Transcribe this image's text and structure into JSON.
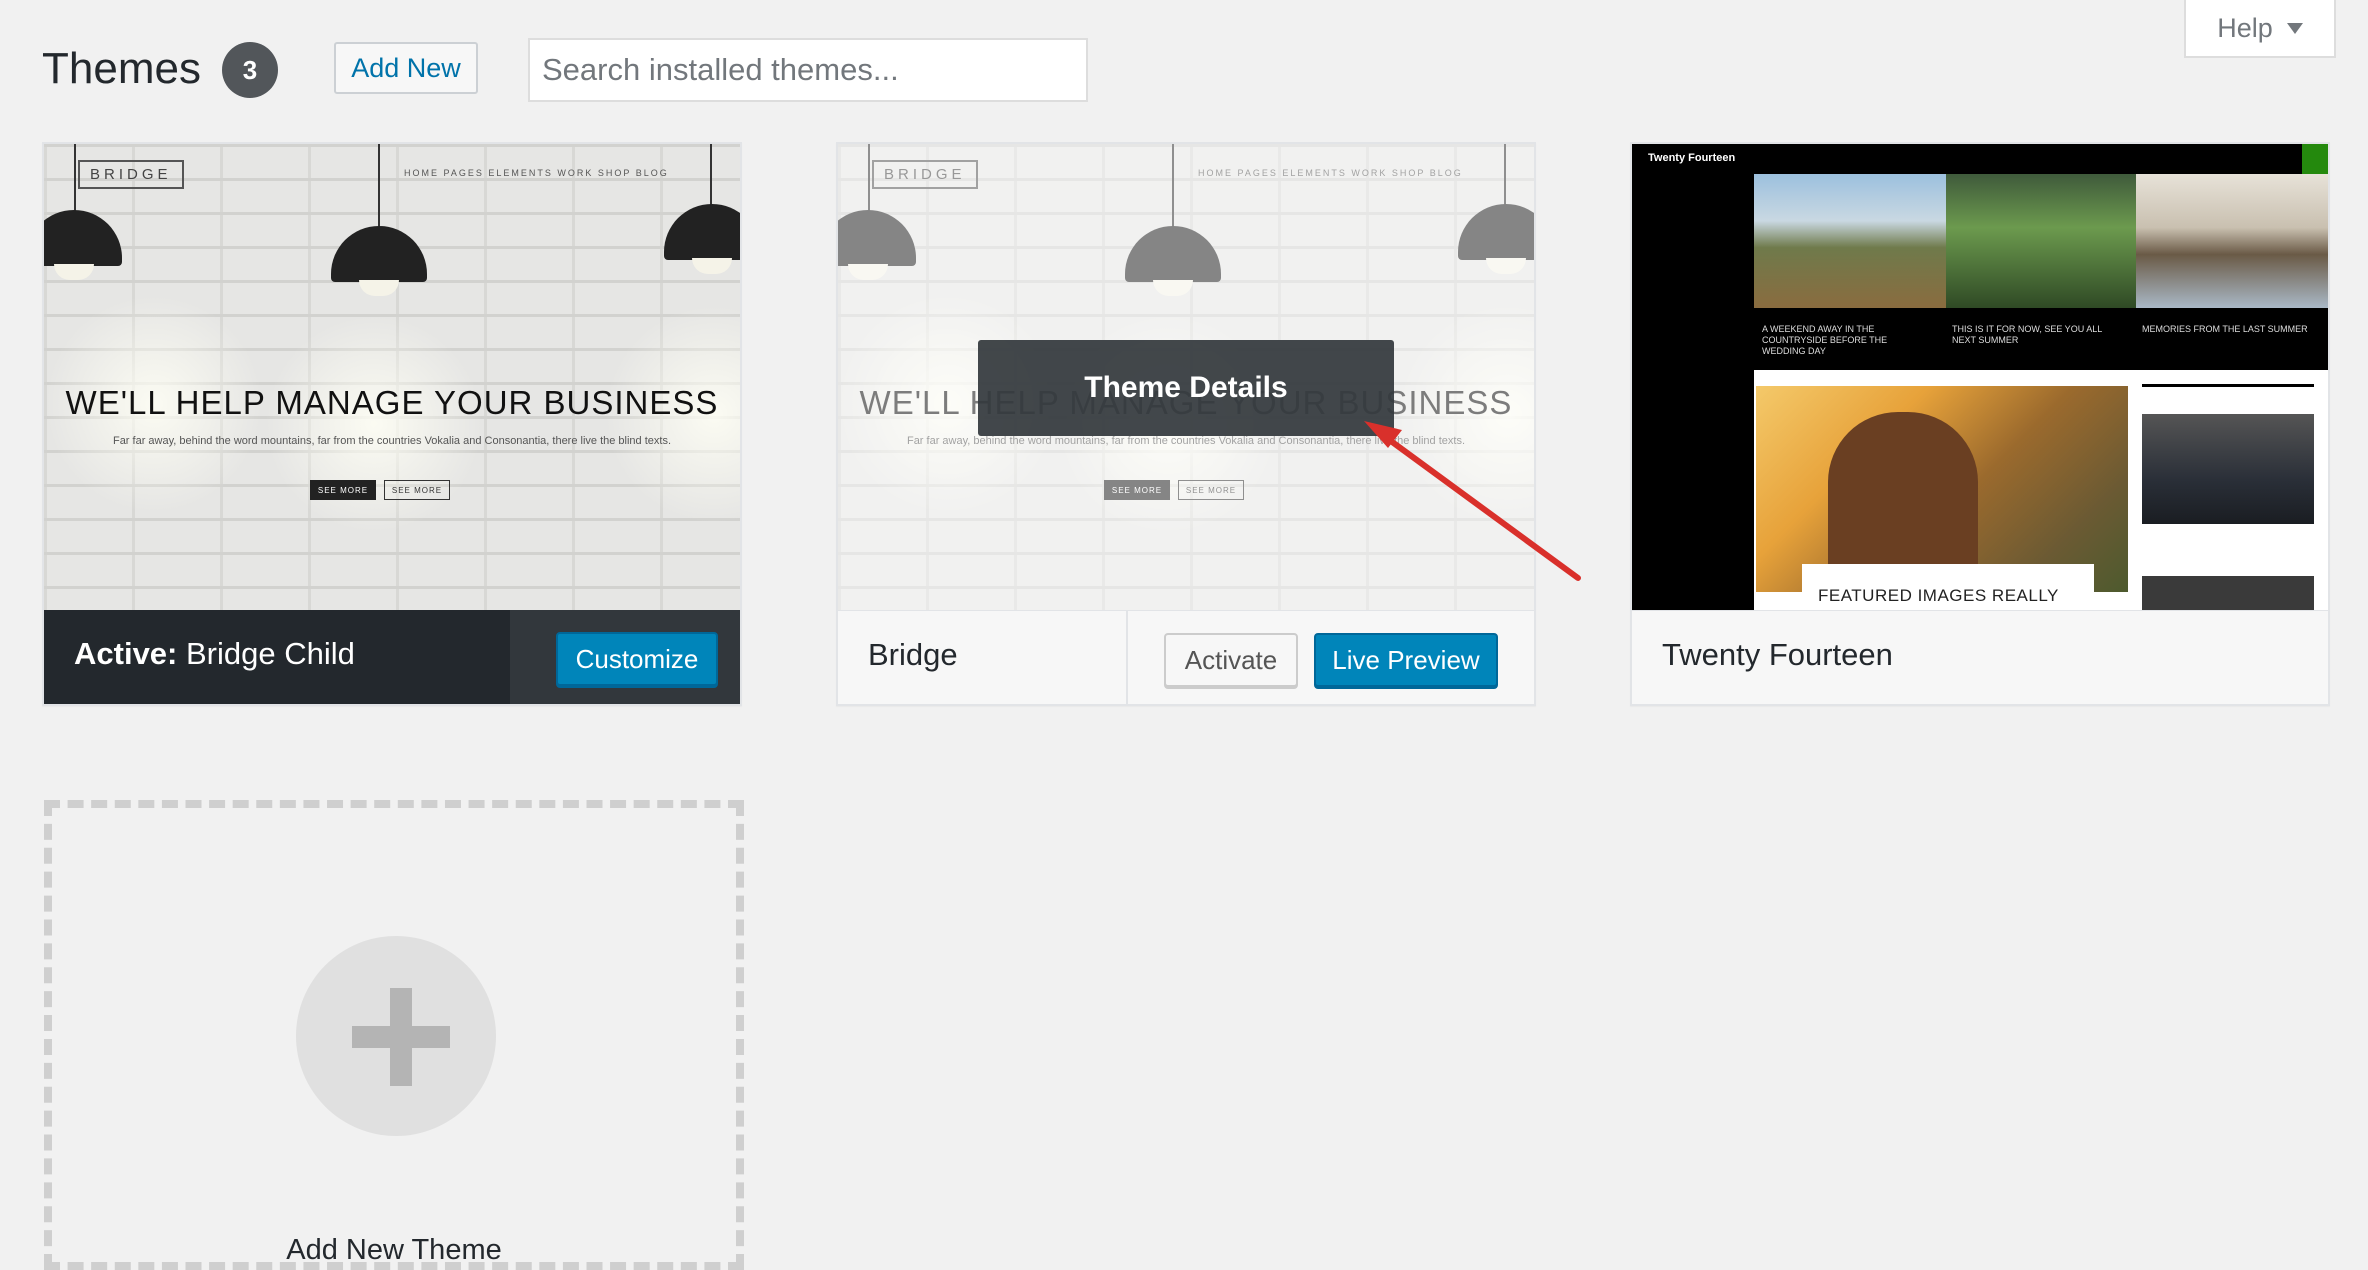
{
  "header": {
    "title": "Themes",
    "count": "3",
    "add_new_label": "Add New",
    "search_placeholder": "Search installed themes...",
    "help_label": "Help"
  },
  "themes": [
    {
      "name": "Bridge Child",
      "active_prefix": "Active:",
      "customize_label": "Customize",
      "screenshot": {
        "logo": "BRIDGE",
        "nav": "HOME   PAGES   ELEMENTS   WORK   SHOP   BLOG",
        "headline": "WE'LL HELP MANAGE YOUR BUSINESS",
        "subtext": "Far far away, behind the word mountains, far from the countries Vokalia and Consonantia, there live the blind texts.",
        "btn1": "SEE MORE",
        "btn2": "SEE MORE"
      }
    },
    {
      "name": "Bridge",
      "activate_label": "Activate",
      "live_preview_label": "Live Preview",
      "details_label": "Theme Details",
      "screenshot": {
        "logo": "BRIDGE",
        "nav": "HOME   PAGES   ELEMENTS   WORK   SHOP   BLOG",
        "headline": "WE'LL HELP MANAGE YOUR BUSINESS",
        "subtext": "Far far away, behind the word mountains, far from the countries Vokalia and Consonantia, there live the blind texts.",
        "btn1": "SEE MORE",
        "btn2": "SEE MORE"
      }
    },
    {
      "name": "Twenty Fourteen",
      "screenshot": {
        "site_title": "Twenty Fourteen",
        "cap1": "A WEEKEND AWAY IN THE COUNTRYSIDE BEFORE THE WEDDING DAY",
        "cap2": "THIS IS IT FOR NOW, SEE YOU ALL NEXT SUMMER",
        "cap3": "MEMORIES FROM THE LAST SUMMER",
        "featured": "FEATURED IMAGES REALLY"
      }
    }
  ],
  "add_new_theme": {
    "label": "Add New Theme"
  },
  "colors": {
    "accent": "#0085ba",
    "link": "#0073aa",
    "active_bar": "#23282d",
    "arrow": "#d9302b"
  }
}
